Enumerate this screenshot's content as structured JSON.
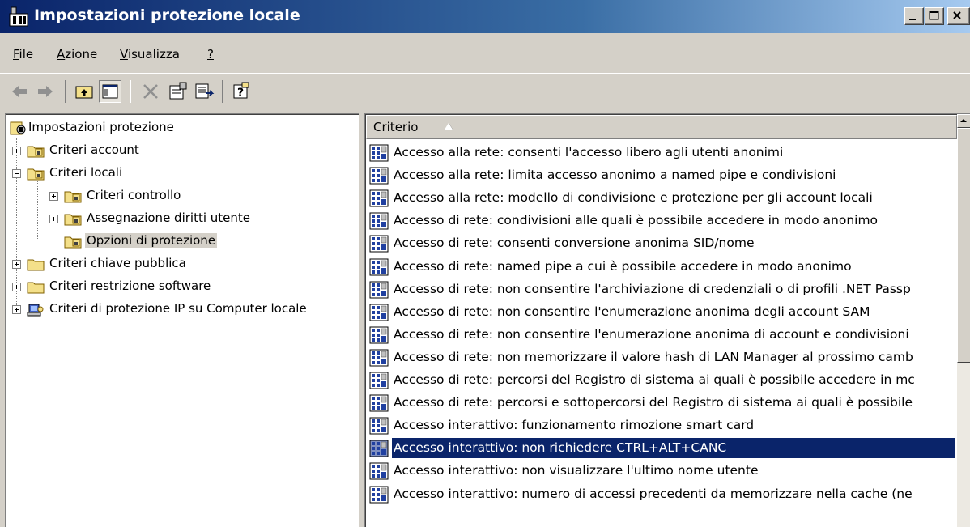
{
  "window": {
    "title": "Impostazioni protezione locale"
  },
  "menu": {
    "items": [
      {
        "label": "File",
        "accel": "F",
        "rest": "ile"
      },
      {
        "label": "Azione",
        "accel": "A",
        "rest": "zione"
      },
      {
        "label": "Visualizza",
        "accel": "V",
        "rest": "isualizza"
      },
      {
        "label": "?",
        "accel": "?",
        "rest": ""
      }
    ]
  },
  "toolbar": {
    "buttons": [
      "back-icon",
      "forward-icon",
      "up-folder-icon",
      "show-hide-tree-icon",
      "delete-icon",
      "properties-icon",
      "export-list-icon",
      "help-icon"
    ]
  },
  "tree": {
    "root": "Impostazioni protezione",
    "items": [
      {
        "label": "Criteri account"
      },
      {
        "label": "Criteri locali"
      },
      {
        "label": "Criteri controllo"
      },
      {
        "label": "Assegnazione diritti utente"
      },
      {
        "label": "Opzioni di protezione"
      },
      {
        "label": "Criteri chiave pubblica"
      },
      {
        "label": "Criteri restrizione software"
      },
      {
        "label": "Criteri di protezione IP su Computer locale"
      }
    ]
  },
  "list": {
    "column_header": "Criterio",
    "rows": [
      "Accesso alla rete: consenti l'accesso libero agli utenti anonimi",
      "Accesso alla rete: limita accesso anonimo a named pipe e condivisioni",
      "Accesso alla rete: modello di condivisione e protezione per gli account locali",
      "Accesso di rete: condivisioni alle quali è possibile accedere in modo anonimo",
      "Accesso di rete: consenti conversione anonima SID/nome",
      "Accesso di rete: named pipe a cui è possibile accedere in modo anonimo",
      "Accesso di rete: non consentire l'archiviazione di credenziali o di profili .NET Passp",
      "Accesso di rete: non consentire l'enumerazione anonima degli account SAM",
      "Accesso di rete: non consentire l'enumerazione anonima di account e condivisioni",
      "Accesso di rete: non memorizzare il valore hash di LAN Manager al prossimo camb",
      "Accesso di rete: percorsi del Registro di sistema ai quali è possibile accedere in mc",
      "Accesso di rete: percorsi e sottopercorsi del Registro di sistema ai quali è possibile",
      "Accesso interattivo: funzionamento rimozione smart card",
      "Accesso interattivo: non richiedere CTRL+ALT+CANC",
      "Accesso interattivo: non visualizzare l'ultimo nome utente",
      "Accesso interattivo: numero di accessi precedenti da memorizzare nella cache (ne"
    ],
    "selected_index": 13
  }
}
